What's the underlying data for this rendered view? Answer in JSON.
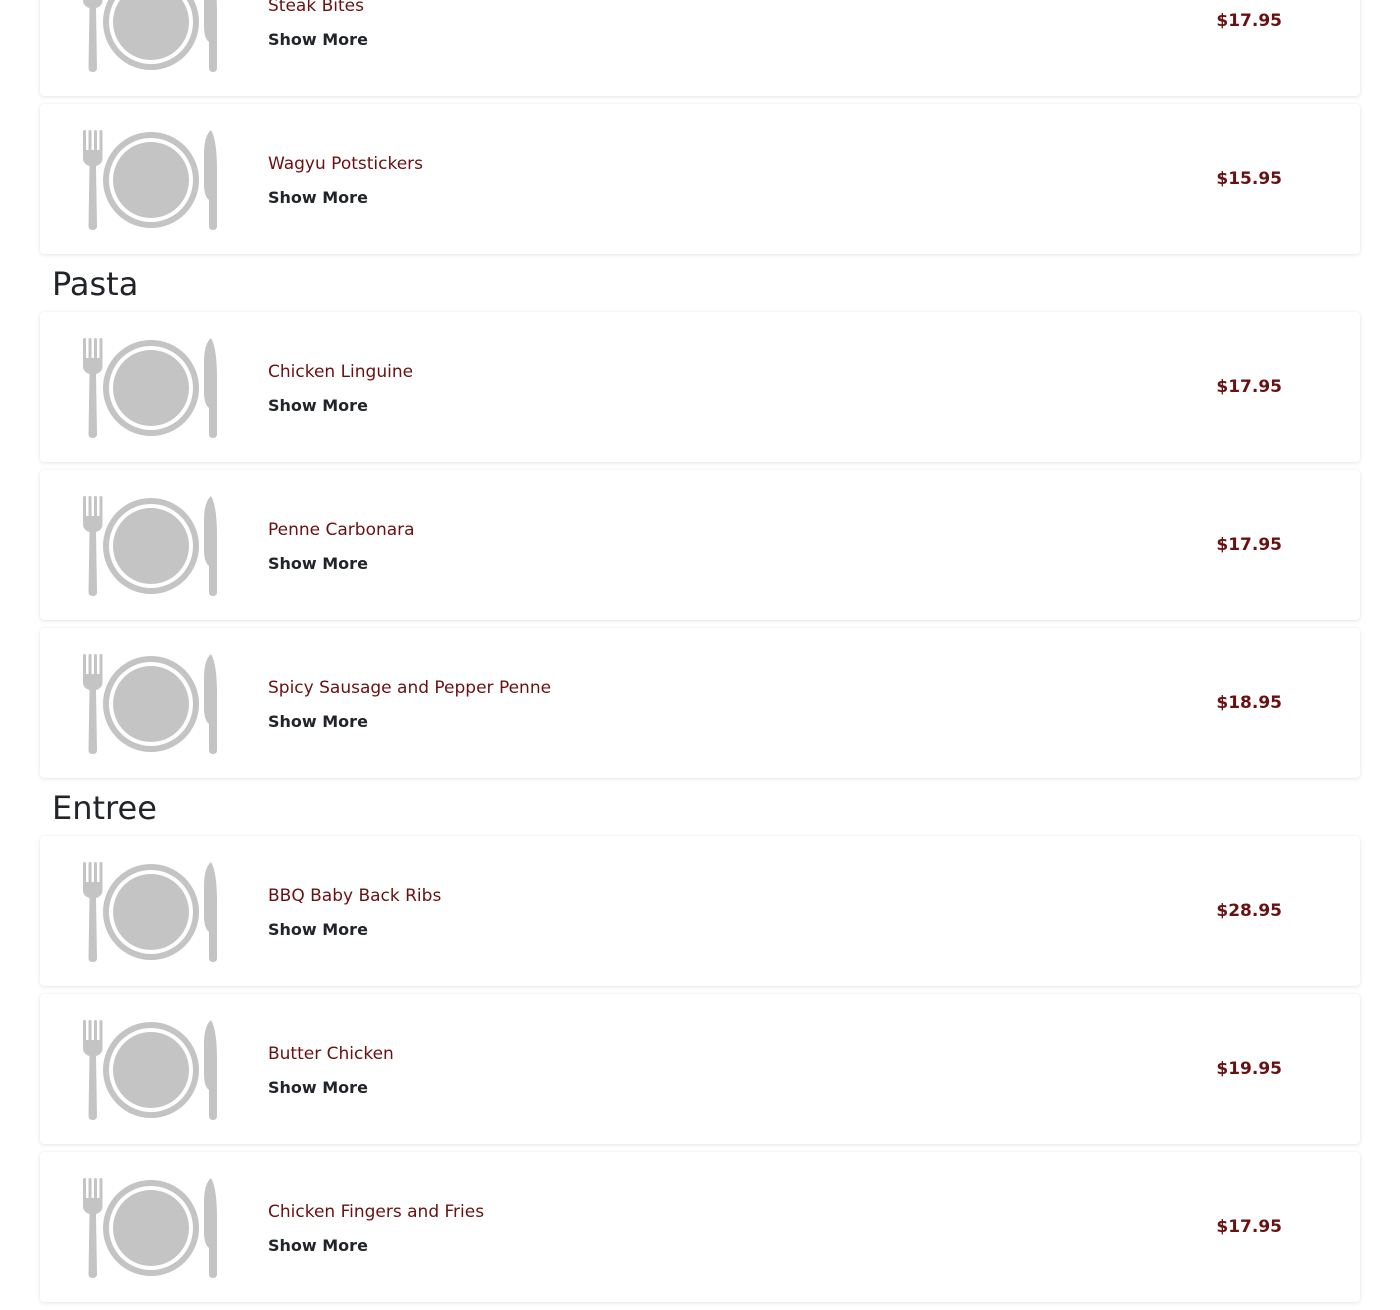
{
  "sections": [
    {
      "title": "",
      "items": [
        {
          "name": "Steak Bites",
          "price": "$17.95",
          "action": "Show More",
          "icon": "plate-fork-knife-icon"
        },
        {
          "name": "Wagyu Potstickers",
          "price": "$15.95",
          "action": "Show More",
          "icon": "plate-fork-knife-icon"
        }
      ]
    },
    {
      "title": "Pasta",
      "items": [
        {
          "name": "Chicken Linguine",
          "price": "$17.95",
          "action": "Show More",
          "icon": "plate-fork-knife-icon"
        },
        {
          "name": "Penne Carbonara",
          "price": "$17.95",
          "action": "Show More",
          "icon": "plate-fork-knife-icon"
        },
        {
          "name": "Spicy Sausage and Pepper Penne",
          "price": "$18.95",
          "action": "Show More",
          "icon": "plate-fork-knife-icon"
        }
      ]
    },
    {
      "title": "Entree",
      "items": [
        {
          "name": "BBQ Baby Back Ribs",
          "price": "$28.95",
          "action": "Show More",
          "icon": "plate-fork-knife-icon"
        },
        {
          "name": "Butter Chicken",
          "price": "$19.95",
          "action": "Show More",
          "icon": "plate-fork-knife-icon"
        },
        {
          "name": "Chicken Fingers and Fries",
          "price": "$17.95",
          "action": "Show More",
          "icon": "plate-fork-knife-icon"
        }
      ]
    }
  ],
  "colors": {
    "item_name": "#6b1010",
    "price": "#6b1010",
    "placeholder_icon": "#c4c4c4"
  }
}
